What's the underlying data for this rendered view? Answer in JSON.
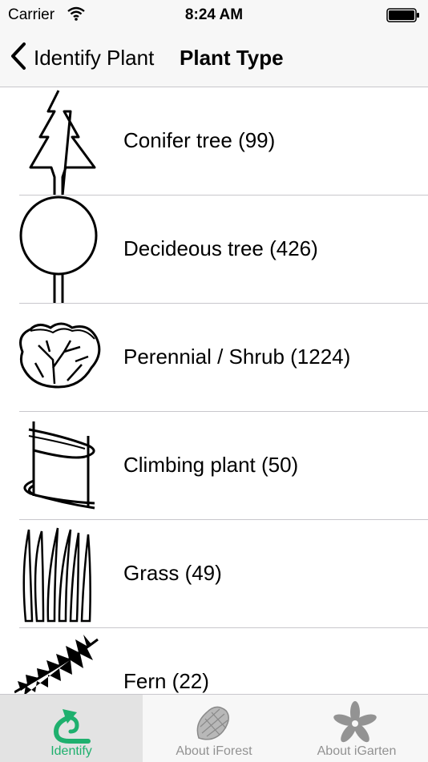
{
  "status_bar": {
    "carrier": "Carrier",
    "time": "8:24 AM"
  },
  "nav": {
    "back_label": "Identify Plant",
    "title": "Plant Type"
  },
  "plant_types": [
    {
      "label": "Conifer tree (99)",
      "icon": "conifer-tree-icon"
    },
    {
      "label": "Decideous tree (426)",
      "icon": "deciduous-tree-icon"
    },
    {
      "label": "Perennial / Shrub (1224)",
      "icon": "shrub-icon"
    },
    {
      "label": "Climbing plant (50)",
      "icon": "climbing-plant-icon"
    },
    {
      "label": "Grass (49)",
      "icon": "grass-icon"
    },
    {
      "label": "Fern (22)",
      "icon": "fern-icon"
    }
  ],
  "tabs": [
    {
      "label": "Identify",
      "icon": "identify-arrow-icon",
      "active": true
    },
    {
      "label": "About iForest",
      "icon": "pine-cone-icon",
      "active": false
    },
    {
      "label": "About iGarten",
      "icon": "flower-icon",
      "active": false
    }
  ],
  "colors": {
    "accent": "#1fb06e",
    "bar_background": "#f7f7f7",
    "separator": "#c8c7cc"
  }
}
